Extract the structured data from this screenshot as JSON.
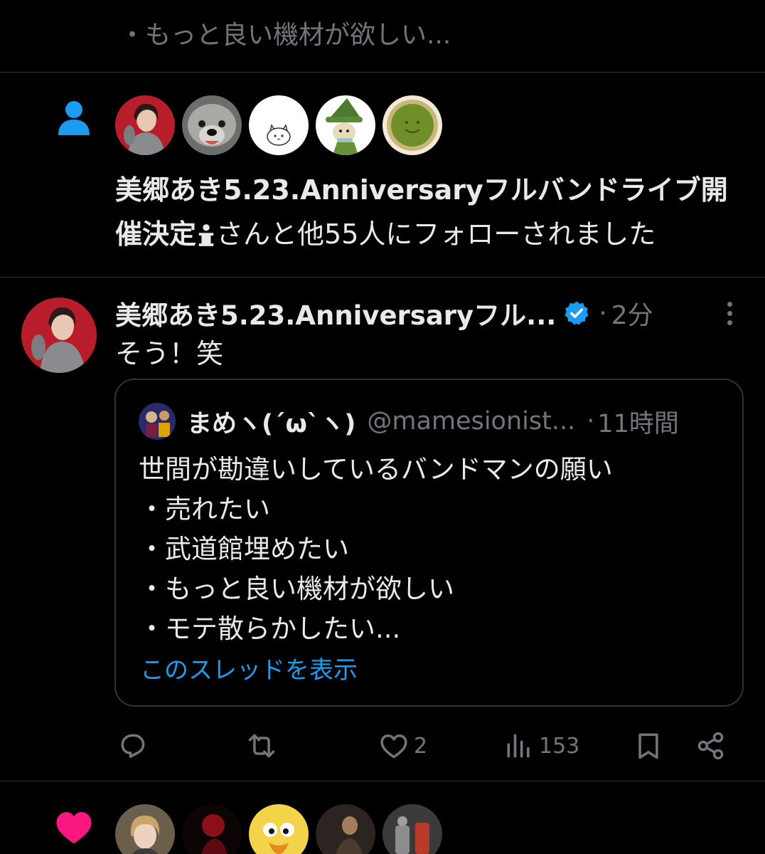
{
  "top": {
    "text": "・もっと良い機材が欲しい..."
  },
  "follow_notification": {
    "name": "美郷あき5.23.Anniversaryフルバンドライブ開催決定",
    "suffix": "さんと他55人にフォローされました",
    "avatars": [
      "avatar-1",
      "avatar-2",
      "avatar-3",
      "avatar-4",
      "avatar-5"
    ]
  },
  "tweet": {
    "name": "美郷あき5.23.Anniversaryフル...",
    "dot": "·",
    "time": "2分",
    "body": "そう！笑",
    "quote": {
      "name": "まめヽ(´ω`ヽ)",
      "handle": "@mamesionist...",
      "dot": "·",
      "time": "11時間",
      "lines": [
        "世間が勘違いしているバンドマンの願い",
        "・売れたい",
        "・武道館埋めたい",
        "・もっと良い機材が欲しい",
        "・モテ散らかしたい..."
      ],
      "show_thread": "このスレッドを表示"
    },
    "actions": {
      "reply_icon": "reply-icon",
      "retweet_icon": "retweet-icon",
      "like_icon": "heart-icon",
      "like_count": "2",
      "views_icon": "views-icon",
      "views_count": "153",
      "bookmark_icon": "bookmark-icon",
      "share_icon": "share-icon"
    }
  },
  "like_notification": {
    "icon": "heart-icon",
    "avatars": [
      "avatar-1",
      "avatar-2",
      "avatar-3",
      "avatar-4",
      "avatar-5"
    ]
  },
  "colors": {
    "background": "#000000",
    "text": "#e7e9ea",
    "muted": "#71767b",
    "accent_blue": "#1d9bf0",
    "heart_pink": "#f91880",
    "divider": "#2f3336"
  }
}
